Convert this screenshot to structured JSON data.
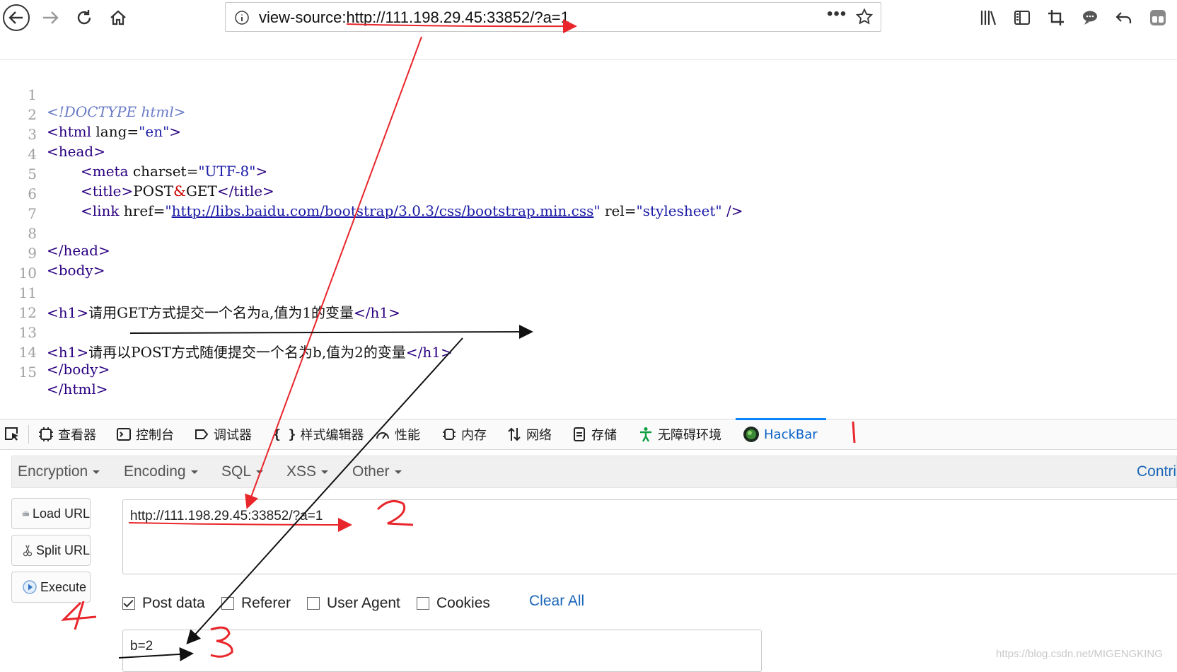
{
  "browser": {
    "url": "view-source:http://111.198.29.45:33852/?a=1",
    "more_label": "•••"
  },
  "source_lines": [
    {
      "num": "1"
    },
    {
      "num": "2"
    },
    {
      "num": "3"
    },
    {
      "num": "4"
    },
    {
      "num": "5"
    },
    {
      "num": "6"
    },
    {
      "num": "7"
    },
    {
      "num": "8"
    },
    {
      "num": "9"
    },
    {
      "num": "10"
    },
    {
      "num": "11"
    },
    {
      "num": "12"
    },
    {
      "num": "13"
    },
    {
      "num": "14"
    },
    {
      "num": "15"
    }
  ],
  "source": {
    "l1": "<!DOCTYPE html>",
    "l2_tag_open": "<html ",
    "l2_attr": "lang=",
    "l2_val": "\"en\"",
    "l2_close": ">",
    "l3": "<head>",
    "l4_open": "<meta ",
    "l4_attr": "charset=",
    "l4_val": "\"UTF-8\"",
    "l4_close": ">",
    "l5_open": "<title>",
    "l5_text1": "POST",
    "l5_amp": "&",
    "l5_text2": "GET",
    "l5_close": "</title>",
    "l6_open": "<link ",
    "l6_attr": "href=",
    "l6_q1": "\"",
    "l6_link": "http://libs.baidu.com/bootstrap/3.0.3/css/bootstrap.min.css",
    "l6_q2": "\"",
    "l6_attr2": " rel=",
    "l6_val2": "\"stylesheet\"",
    "l6_close": " />",
    "l8": "</head>",
    "l9": "<body>",
    "l11_open": "<h1>",
    "l11_text": "请用GET方式提交一个名为a,值为1的变量",
    "l11_close": "</h1>",
    "l13_open": "<h1>",
    "l13_text": "请再以POST方式随便提交一个名为b,值为2的变量",
    "l13_close": "</h1>",
    "l14": "</body>",
    "l15": "</html>"
  },
  "devtools": {
    "tabs": [
      "查看器",
      "控制台",
      "调试器",
      "样式编辑器",
      "性能",
      "内存",
      "网络",
      "存储",
      "无障碍环境",
      "HackBar"
    ],
    "active_tab": "HackBar"
  },
  "hackbar": {
    "menu": [
      "Encryption",
      "Encoding",
      "SQL",
      "XSS",
      "Other"
    ],
    "contrib": "Contrib",
    "buttons": {
      "load": "Load URL",
      "split": "Split URL",
      "execute": "Execute"
    },
    "url_value": "http://111.198.29.45:33852/?a=1",
    "options": {
      "post": "Post data",
      "referer": "Referer",
      "useragent": "User Agent",
      "cookies": "Cookies"
    },
    "post_checked": true,
    "clear_all": "Clear All",
    "post_value": "b=2"
  },
  "annotations": {
    "n1": "1",
    "n2": "2",
    "n3": "3",
    "n4": "4",
    "color_red": "#e8262b",
    "color_black": "#111111"
  },
  "watermark": "https://blog.csdn.net/MIGENGKING"
}
